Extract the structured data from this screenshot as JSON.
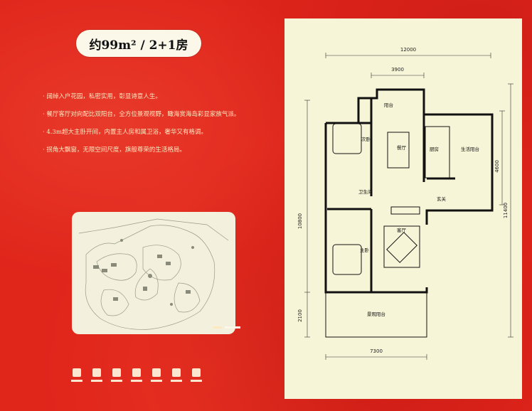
{
  "title": {
    "text": "约99m² / 2+1房"
  },
  "features": [
    "· 阔绰入户花园，私密实用，彰显诗意人生。",
    "· 餐厅客厅对向配比双阳台，全方位景观视野，瞰海赏海岛彩显家族气派。",
    "· 4.3m超大主卧开间，内置主人房和属卫浴，奢华又有格调。",
    "· 拐角大飘窗，无限空间尺度，旗般尊荣的生活格局。"
  ],
  "floorplan": {
    "dimensions": {
      "top_total": "12000",
      "top_inner": "3900",
      "left_total": "10800",
      "right_upper": "4600",
      "right_total": "11400",
      "left_lower": "2100",
      "bottom": "7300"
    },
    "rooms": {
      "balcony_top": "阳台",
      "second_bedroom": "次卧",
      "dining": "餐厅",
      "kitchen": "厨房",
      "utility_balcony": "生活阳台",
      "bathroom": "卫生间",
      "foyer": "玄关",
      "living": "客厅",
      "master_bedroom": "主卧",
      "view_balcony": "景观阳台"
    }
  },
  "colors": {
    "background": "#e0251b",
    "panel": "#f6f5d8",
    "pill": "#fbf8ea",
    "feature_text": "#fde8c0"
  }
}
